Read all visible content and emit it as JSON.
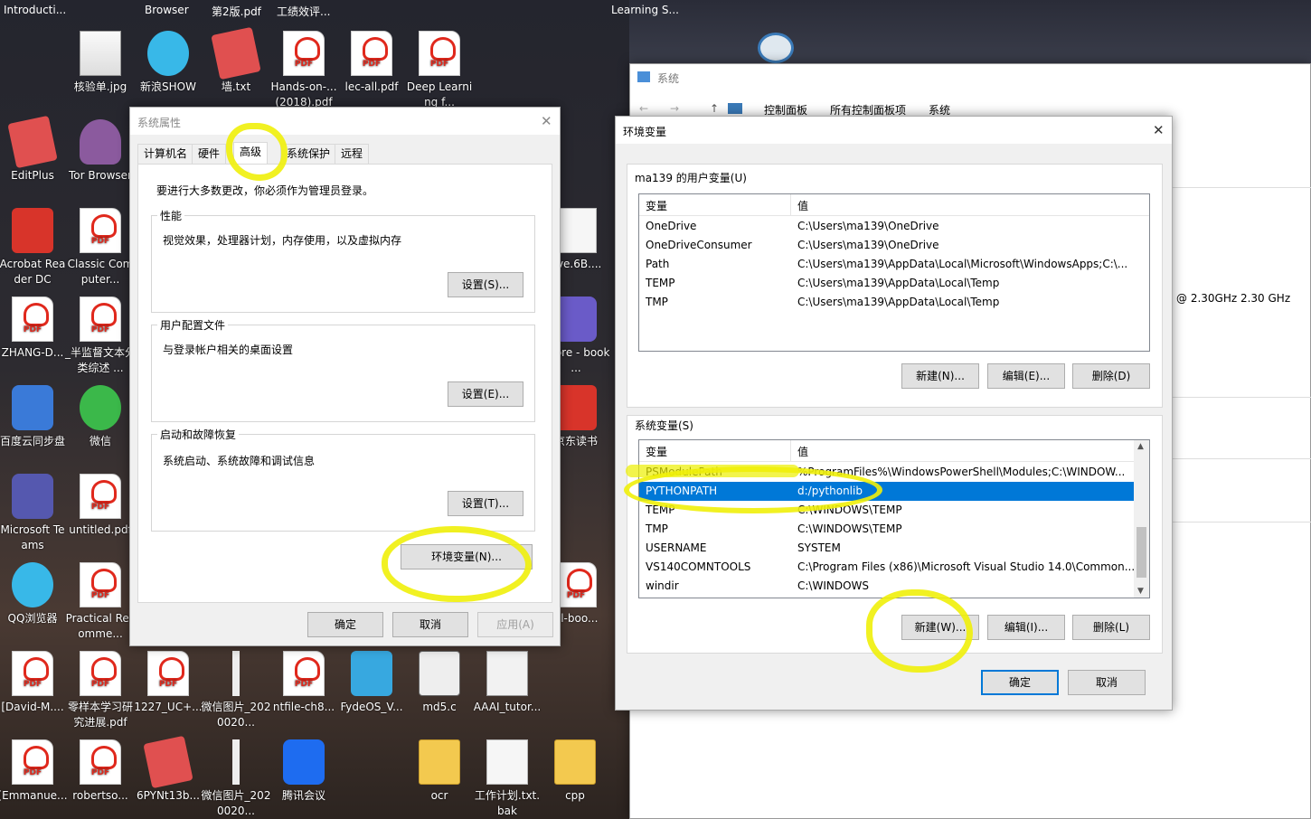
{
  "desktop": {
    "top_row": [
      "Introducti...",
      "Browser",
      "第2版.pdf",
      "工绩效评...",
      "Learning S..."
    ],
    "icons": [
      {
        "id": "i1",
        "label": "核验单.jpg",
        "kind": "img"
      },
      {
        "id": "i2",
        "label": "新浪SHOW",
        "kind": "app-cyan"
      },
      {
        "id": "i3",
        "label": "墙.txt",
        "kind": "app-note"
      },
      {
        "id": "i4",
        "label": "Hands-on-...(2018).pdf",
        "kind": "pdf"
      },
      {
        "id": "i5",
        "label": "lec-all.pdf",
        "kind": "pdf"
      },
      {
        "id": "i6",
        "label": "Deep Learning f...",
        "kind": "pdf"
      },
      {
        "id": "i7",
        "label": "EditPlus",
        "kind": "app-note"
      },
      {
        "id": "i8",
        "label": "Tor Browser",
        "kind": "app-tor"
      },
      {
        "id": "i9",
        "label": "Acrobat Reader DC",
        "kind": "app-red"
      },
      {
        "id": "i10",
        "label": "Classic Computer...",
        "kind": "pdf"
      },
      {
        "id": "i11",
        "label": "ZHANG-D...",
        "kind": "pdf"
      },
      {
        "id": "i12",
        "label": "_半监督文本分类综述 ...",
        "kind": "pdf"
      },
      {
        "id": "i13",
        "label": "百度云同步盘",
        "kind": "app-blue"
      },
      {
        "id": "i14",
        "label": "微信",
        "kind": "app-green"
      },
      {
        "id": "i15",
        "label": "Microsoft Teams",
        "kind": "app-teams"
      },
      {
        "id": "i16",
        "label": "untitled.pdf",
        "kind": "pdf"
      },
      {
        "id": "i17",
        "label": "QQ浏览器",
        "kind": "app-cyan"
      },
      {
        "id": "i18",
        "label": "Practical Recomme...",
        "kind": "pdf"
      },
      {
        "id": "i19",
        "label": "[David-M....",
        "kind": "pdf"
      },
      {
        "id": "i20",
        "label": "零样本学习研究进展.pdf",
        "kind": "pdf"
      },
      {
        "id": "i21",
        "label": "1227_UC+...",
        "kind": "pdf"
      },
      {
        "id": "i22",
        "label": "微信图片_2020020...",
        "kind": "app-line"
      },
      {
        "id": "i23",
        "label": "ntfile-ch8...",
        "kind": "pdf"
      },
      {
        "id": "i24",
        "label": "FydeOS_V...",
        "kind": "app-cube"
      },
      {
        "id": "i25",
        "label": "md5.c",
        "kind": "app-c"
      },
      {
        "id": "i26",
        "label": "AAAI_tutor...",
        "kind": "app-ppt"
      },
      {
        "id": "i27",
        "label": "[Emmanue...",
        "kind": "pdf"
      },
      {
        "id": "i28",
        "label": "robertso...",
        "kind": "pdf"
      },
      {
        "id": "i29",
        "label": "6PYNt13b...",
        "kind": "app-note"
      },
      {
        "id": "i30",
        "label": "微信图片_2020020...",
        "kind": "app-line"
      },
      {
        "id": "i31",
        "label": "腾讯会议",
        "kind": "app-mt"
      },
      {
        "id": "i32",
        "label": "ocr",
        "kind": "folder"
      },
      {
        "id": "i33",
        "label": "工作计划.txt.bak",
        "kind": "doc"
      },
      {
        "id": "i34",
        "label": "cpp",
        "kind": "folder"
      },
      {
        "id": "i35",
        "label": "ove.6B....",
        "kind": "doc"
      },
      {
        "id": "i36",
        "label": "alibre - book ...",
        "kind": "app-purple"
      },
      {
        "id": "i37",
        "label": "京东读书",
        "kind": "app-red"
      },
      {
        "id": "i38",
        "label": "dl-boo...",
        "kind": "pdf"
      }
    ]
  },
  "system_window": {
    "title": "系统",
    "breadcrumb": [
      "控制面板",
      "所有控制面板项",
      "系统"
    ],
    "cpu_text": "@ 2.30GHz   2.30 GHz"
  },
  "sys_props": {
    "title": "系统属性",
    "tabs": [
      "计算机名",
      "硬件",
      "高级",
      "系统保护",
      "远程"
    ],
    "admin_note": "要进行大多数更改，你必须作为管理员登录。",
    "perf": {
      "title": "性能",
      "desc": "视觉效果，处理器计划，内存使用，以及虚拟内存",
      "button": "设置(S)..."
    },
    "profile": {
      "title": "用户配置文件",
      "desc": "与登录帐户相关的桌面设置",
      "button": "设置(E)..."
    },
    "startup": {
      "title": "启动和故障恢复",
      "desc": "系统启动、系统故障和调试信息",
      "button": "设置(T)..."
    },
    "env_button": "环境变量(N)...",
    "ok": "确定",
    "cancel": "取消",
    "apply": "应用(A)"
  },
  "env_dialog": {
    "title": "环境变量",
    "user_group": "ma139 的用户变量(U)",
    "col_var": "变量",
    "col_val": "值",
    "user_vars": [
      {
        "name": "OneDrive",
        "value": "C:\\Users\\ma139\\OneDrive"
      },
      {
        "name": "OneDriveConsumer",
        "value": "C:\\Users\\ma139\\OneDrive"
      },
      {
        "name": "Path",
        "value": "C:\\Users\\ma139\\AppData\\Local\\Microsoft\\WindowsApps;C:\\..."
      },
      {
        "name": "TEMP",
        "value": "C:\\Users\\ma139\\AppData\\Local\\Temp"
      },
      {
        "name": "TMP",
        "value": "C:\\Users\\ma139\\AppData\\Local\\Temp"
      }
    ],
    "user_buttons": {
      "new": "新建(N)...",
      "edit": "编辑(E)...",
      "delete": "删除(D)"
    },
    "sys_group": "系统变量(S)",
    "sys_vars": [
      {
        "name": "PSModulePath",
        "value": "%ProgramFiles%\\WindowsPowerShell\\Modules;C:\\WINDOW..."
      },
      {
        "name": "PYTHONPATH",
        "value": "d:/pythonlib",
        "selected": true
      },
      {
        "name": "TEMP",
        "value": "C:\\WINDOWS\\TEMP"
      },
      {
        "name": "TMP",
        "value": "C:\\WINDOWS\\TEMP"
      },
      {
        "name": "USERNAME",
        "value": "SYSTEM"
      },
      {
        "name": "VS140COMNTOOLS",
        "value": "C:\\Program Files (x86)\\Microsoft Visual Studio 14.0\\Common..."
      },
      {
        "name": "windir",
        "value": "C:\\WINDOWS"
      }
    ],
    "sys_buttons": {
      "new": "新建(W)...",
      "edit": "编辑(I)...",
      "delete": "删除(L)"
    },
    "ok": "确定",
    "cancel": "取消"
  },
  "colors": {
    "selection": "#0078d7",
    "highlighter": "#f0f00a",
    "default_border": "#0078d7"
  }
}
